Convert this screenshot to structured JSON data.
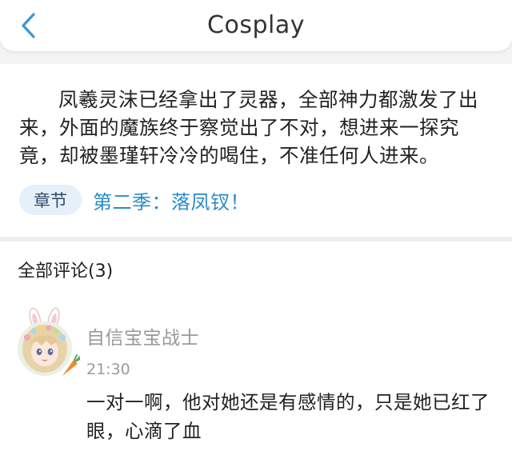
{
  "header": {
    "title": "Cosplay",
    "back_icon": "chevron-left-icon"
  },
  "content": {
    "paragraph": "凤羲灵沫已经拿出了灵器，全部神力都激发了出来，外面的魔族终于察觉出了不对，想进来一探究竟，却被墨瑾轩冷冷的喝住，不准任何人进来。",
    "chapter_tag": "章节",
    "chapter_link": "第二季：落凤钗！"
  },
  "comments": {
    "title": "全部评论(3)",
    "items": [
      {
        "avatar_icon": "anime-girl-bunny-ears-avatar",
        "user": "自信宝宝战士",
        "time": "21:30",
        "text": "一对一啊，他对她还是有感情的，只是她已红了眼，心滴了血"
      }
    ]
  },
  "colors": {
    "accent": "#2a8bc9",
    "back_icon": "#3b97d3",
    "tag_bg": "#e5f0fb",
    "muted": "#999999"
  }
}
